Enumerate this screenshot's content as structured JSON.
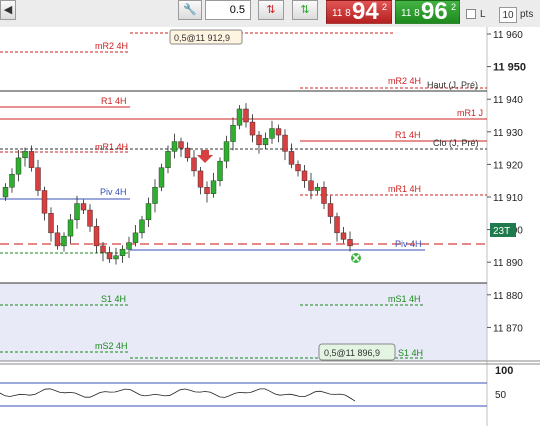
{
  "toolbar": {
    "trade_label": "0",
    "quantity_value": "0.5",
    "sell": {
      "small": "11 8",
      "big": "94",
      "sup": "2"
    },
    "buy": {
      "small": "11 8",
      "big": "96",
      "sup": "2"
    },
    "checkbox_label": "L",
    "points_value": "10",
    "points_label": "pts"
  },
  "price_axis": [
    "11 960",
    "11 950",
    "11 940",
    "11 930",
    "11 920",
    "11 910",
    "11 900",
    "11 890",
    "11 880",
    "11 870"
  ],
  "price_axis_bold": "11 950",
  "current_price_tag": "23T",
  "levels": {
    "mR2_left": "mR2 4H",
    "mR2_right": "mR2 4H",
    "haut": "Haut (J, Pré)",
    "R1_left": "R1 4H",
    "R1_right": "R1 4H",
    "mR1_j": "mR1 J",
    "mR1_left": "mR1 4H",
    "clo": "Clo (J, Pré)",
    "mR1_right": "mR1 4H",
    "piv_left": "Piv 4H",
    "piv_right": "Piv 4H",
    "S1_left": "S1 4H",
    "mS1_right": "mS1 4H",
    "mS2_left": "mS2 4H",
    "S1_right": "S1 4H"
  },
  "order_tags": {
    "top": "0,5@11 912,9",
    "bottom": "0,5@11 896,9"
  },
  "indicator_axis": [
    "100",
    "50"
  ],
  "colors": {
    "up": "#2fae2f",
    "down": "#d64040",
    "pivot": "#3a4fb5",
    "resistance": "#cc2222",
    "support": "#1a8a1a"
  }
}
